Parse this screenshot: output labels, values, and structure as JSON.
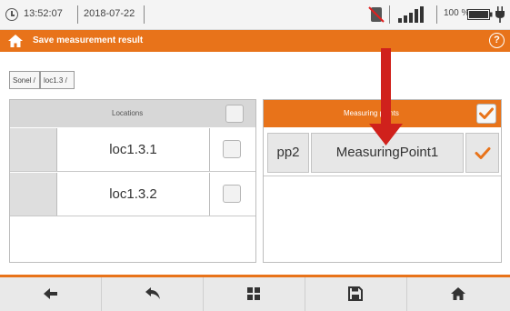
{
  "status_bar": {
    "time": "13:52:07",
    "date": "2018-07-22",
    "battery_percent": "100 %"
  },
  "title_bar": {
    "title": "Save measurement result",
    "help_symbol": "?"
  },
  "breadcrumb": [
    "Sonel /",
    "loc1.3 /"
  ],
  "locations_panel": {
    "header": "Locations",
    "items": [
      {
        "name": "loc1.3.1",
        "checked": false
      },
      {
        "name": "loc1.3.2",
        "checked": false
      }
    ]
  },
  "points_panel": {
    "header": "Measuring points",
    "header_checked": true,
    "items": [
      {
        "code": "pp2",
        "name": "MeasuringPoint1",
        "checked": true
      }
    ]
  },
  "footer_buttons": [
    {
      "icon": "arrow-left-icon"
    },
    {
      "icon": "undo-arrow-icon"
    },
    {
      "icon": "grid-icon"
    },
    {
      "icon": "floppy-disk-icon"
    },
    {
      "icon": "home-icon"
    }
  ],
  "colors": {
    "accent": "#e8731a",
    "annotation_arrow": "#d0211c"
  }
}
